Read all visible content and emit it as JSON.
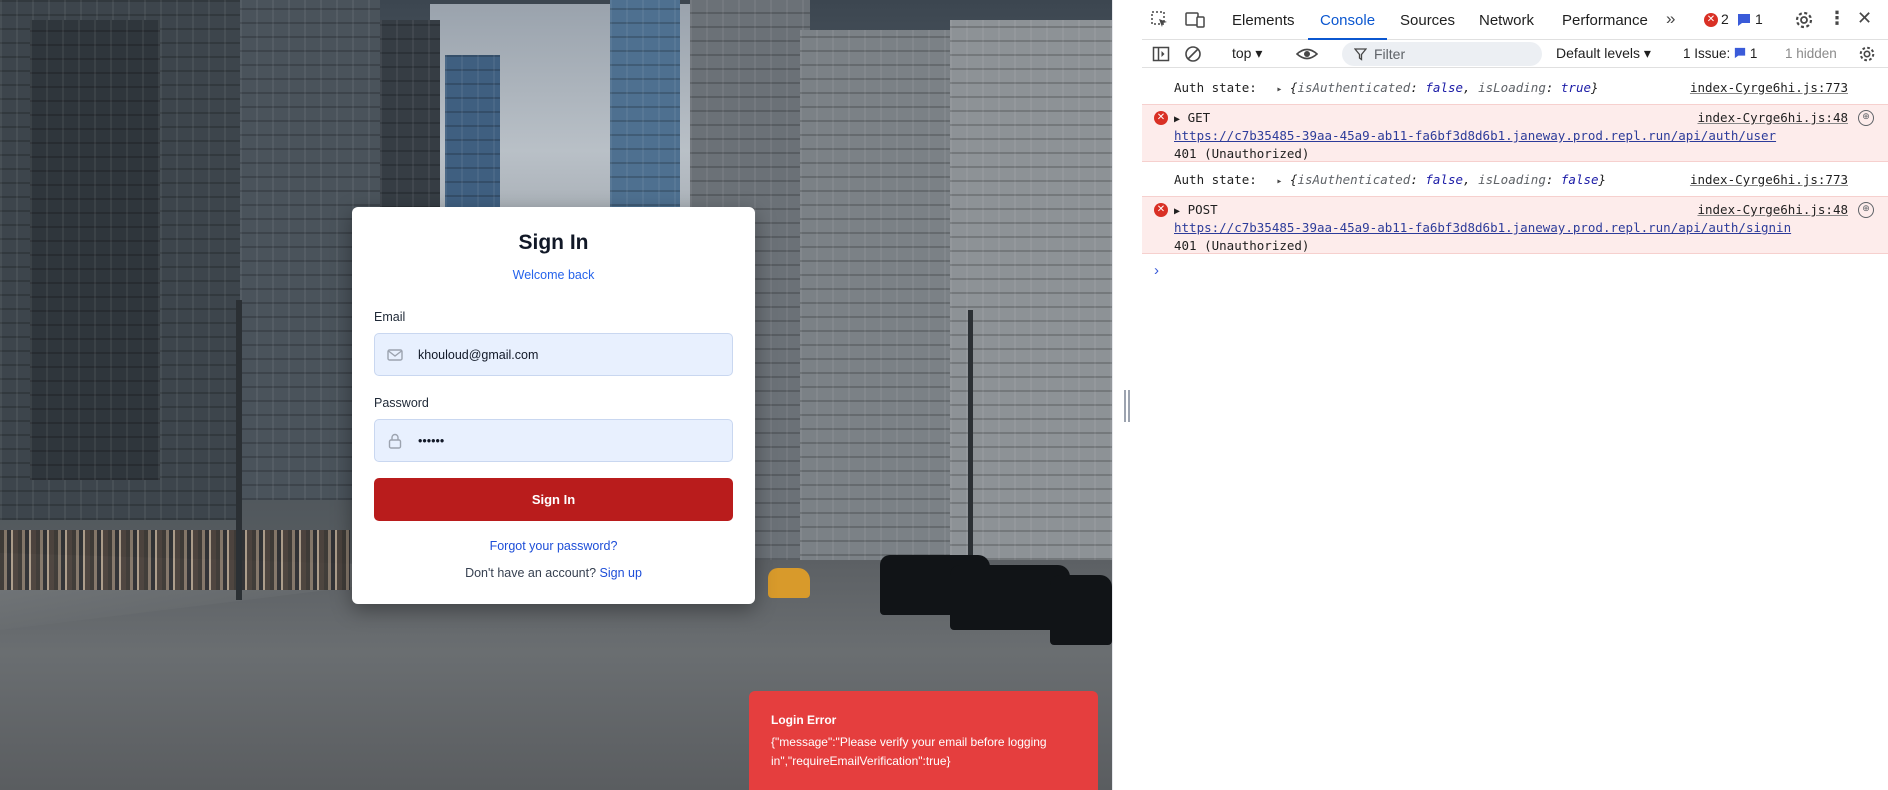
{
  "login": {
    "title": "Sign In",
    "subtitle": "Welcome back",
    "email_label": "Email",
    "email_value": "khouloud@gmail.com",
    "password_label": "Password",
    "password_value": "••••••",
    "submit_label": "Sign In",
    "forgot_label": "Forgot your password?",
    "no_account_text": "Don't have an account?",
    "signup_label": "Sign up",
    "accent": "#b91c1c"
  },
  "toast": {
    "title": "Login Error",
    "body": "{\"message\":\"Please verify your email before logging in\",\"requireEmailVerification\":true}",
    "color": "#e53e3e"
  },
  "devtools": {
    "tabs": [
      {
        "label": "Elements"
      },
      {
        "label": "Console",
        "active": true
      },
      {
        "label": "Sources"
      },
      {
        "label": "Network"
      },
      {
        "label": "Performance"
      }
    ],
    "error_count": "2",
    "message_count": "1",
    "context": "top",
    "filter_placeholder": "Filter",
    "levels_label": "Default levels",
    "issues_label": "1 Issue:",
    "issues_count": "1",
    "hidden_label": "1 hidden",
    "messages": [
      {
        "type": "log",
        "prefix": "Auth state:",
        "obj_open": "{",
        "key1": "isAuthenticated",
        "val1": "false",
        "key2": "isLoading",
        "val2": "true",
        "obj_close": "}",
        "source": "index-Cyrge6hi.js:773"
      },
      {
        "type": "error",
        "method": "GET",
        "url": "https://c7b35485-39aa-45a9-ab11-fa6bf3d8d6b1.janeway.prod.repl.run/api/auth/user",
        "status": "401 (Unauthorized)",
        "source": "index-Cyrge6hi.js:48"
      },
      {
        "type": "log",
        "prefix": "Auth state:",
        "obj_open": "{",
        "key1": "isAuthenticated",
        "val1": "false",
        "key2": "isLoading",
        "val2": "false",
        "obj_close": "}",
        "source": "index-Cyrge6hi.js:773"
      },
      {
        "type": "error",
        "method": "POST",
        "url": "https://c7b35485-39aa-45a9-ab11-fa6bf3d8d6b1.janeway.prod.repl.run/api/auth/signin",
        "status": "401 (Unauthorized)",
        "source": "index-Cyrge6hi.js:48"
      }
    ],
    "icons": [
      "inspect-icon",
      "device-toggle-icon",
      "overflow-chevrons-icon",
      "error-icon",
      "message-icon",
      "settings-gear-icon",
      "more-vert-icon",
      "close-icon",
      "sidebar-toggle-icon",
      "clear-console-icon",
      "eye-icon",
      "filter-icon",
      "prompt-chevron-icon"
    ]
  }
}
